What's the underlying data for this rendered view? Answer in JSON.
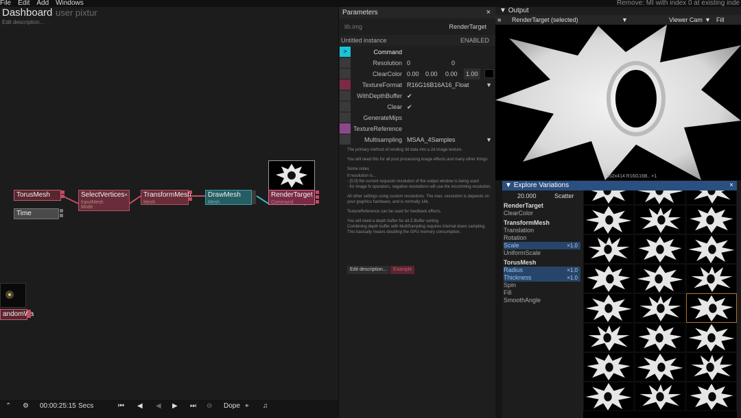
{
  "menubar": {
    "items": [
      "File",
      "Edit",
      "Add",
      "Windows"
    ],
    "status": "Remove: MI with index 0 at existing inde"
  },
  "graph": {
    "title": "Dashboard",
    "subtitle": "user pixtur",
    "edit_description": "Edit description...",
    "nodes": {
      "torus": {
        "label": "TorusMesh"
      },
      "time": {
        "label": "Time"
      },
      "select": {
        "label": "SelectVertices",
        "sub1": "InputMesh",
        "sub2": "Mode"
      },
      "transform": {
        "label": "TransformMesh",
        "sub": "Mesh"
      },
      "draw": {
        "label": "DrawMesh",
        "sub": "Mesh"
      },
      "render": {
        "label": "RenderTarget",
        "sub": "Command"
      },
      "random": {
        "label": "andomWa"
      }
    }
  },
  "timeline": {
    "time": "00:00:25:15",
    "unit": "Secs",
    "mode": "Dope"
  },
  "params": {
    "title": "Parameters",
    "lib": "lib.img",
    "type": "RenderTarget",
    "instance": "Untitled instance",
    "enabled": "ENABLED",
    "rows": [
      {
        "label": "Command",
        "value": ""
      },
      {
        "label": "Resolution",
        "v1": "0",
        "v2": "0"
      },
      {
        "label": "ClearColor",
        "c": [
          "0.00",
          "0.00",
          "0.00",
          "1.00"
        ]
      },
      {
        "label": "TextureFormat",
        "value": "R16G16B16A16_Float"
      },
      {
        "label": "WithDepthBuffer",
        "value": "✔"
      },
      {
        "label": "Clear",
        "value": "✔"
      },
      {
        "label": "GenerateMips",
        "value": ""
      },
      {
        "label": "TextureReference",
        "value": ""
      },
      {
        "label": "Multisampling",
        "value": "MSAA_4Samples"
      }
    ],
    "help": [
      "The primary method of rending 3d data into a 2d image texture.",
      "You will need this for all post processing image effects and many other things.",
      "Some notes",
      "If resolution is...",
      "- [0,0] the current requests resolution of the output window is being used",
      "- for image fx operators, negative resolutions will use the incomming resolution.",
      "All other settings using custom resolutions. The max. resolution is depends on your graphics hardware, and is normally 16k.",
      "TextureReference can be used for feedback effects.",
      "You will need a depth buffer for all Z-Buffer sorting",
      "Combining depth buffer with MultiSampling requires internal down sampling. This basically means doubling the GPU memory consumption."
    ],
    "btn_edit": "Edit description...",
    "btn_example": "Example"
  },
  "output": {
    "title": "Output",
    "target": "RenderTarget (selected)",
    "camera": "Viewer Cam",
    "fill": "Fill",
    "footer": "652x414  R16G16B..  ×1"
  },
  "explore": {
    "title": "Explore Variations",
    "amount": "20.000",
    "mode": "Scatter",
    "rows": [
      {
        "label": "RenderTarget",
        "group": true
      },
      {
        "label": "ClearColor"
      },
      {
        "label": "TransformMesh",
        "group": true
      },
      {
        "label": "Translation"
      },
      {
        "label": "Rotation"
      },
      {
        "label": "Scale",
        "sel": true,
        "mult": "×1.0"
      },
      {
        "label": "UniformScale"
      },
      {
        "label": "TorusMesh",
        "group": true
      },
      {
        "label": "Radius",
        "sel": true,
        "mult": "×1.0"
      },
      {
        "label": "Thickness",
        "sel": true,
        "mult": "×1.0"
      },
      {
        "label": "Spin"
      },
      {
        "label": "Fill"
      },
      {
        "label": "SmoothAngle"
      }
    ]
  },
  "colors": {
    "accent": "#2a4f80",
    "node_red": "#7a2f3a",
    "node_teal": "#2f7f80",
    "node_gray": "#555555"
  }
}
